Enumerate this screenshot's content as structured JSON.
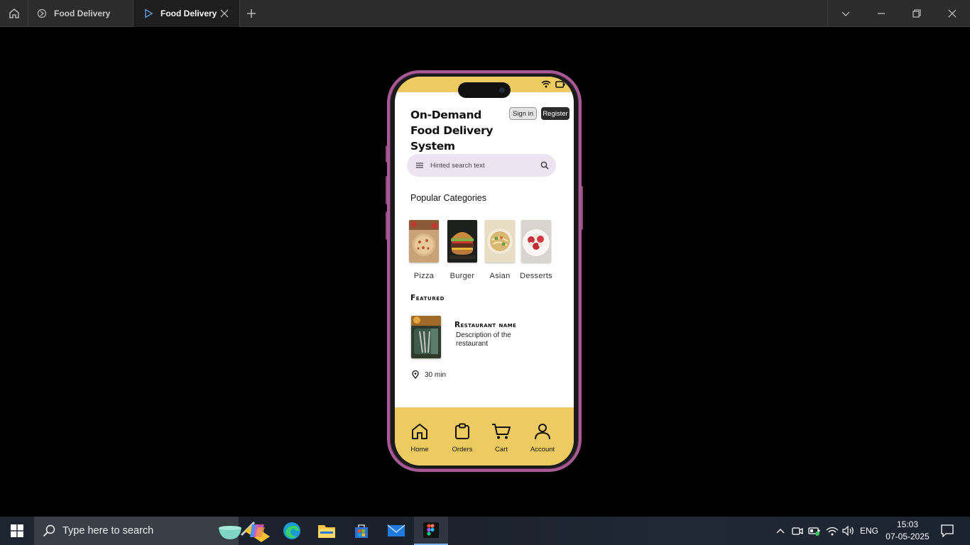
{
  "window": {
    "tabs": [
      {
        "label": "Food Delivery"
      },
      {
        "label": "Food Delivery"
      }
    ]
  },
  "app": {
    "title": "On-Demand Food Delivery System",
    "signin_label": "Sign in",
    "register_label": "Register",
    "search": {
      "placeholder": "Hinted search text"
    },
    "categories_heading": "Popular Categories",
    "categories": [
      {
        "label": "Pizza"
      },
      {
        "label": "Burger"
      },
      {
        "label": "Asian"
      },
      {
        "label": "Desserts"
      }
    ],
    "featured_heading": "Featured",
    "featured": {
      "name": "Restaurant name",
      "description": "Description of the restaurant",
      "time": "30 min"
    },
    "nav": [
      {
        "label": "Home",
        "icon": "home-icon"
      },
      {
        "label": "Orders",
        "icon": "clipboard-icon"
      },
      {
        "label": "Cart",
        "icon": "cart-icon"
      },
      {
        "label": "Account",
        "icon": "person-icon"
      }
    ],
    "colors": {
      "accent": "#eecb60",
      "frame": "#a95a96"
    }
  },
  "taskbar": {
    "search_placeholder": "Type here to search",
    "language": "ENG",
    "time": "15:03",
    "date": "07-05-2025"
  }
}
